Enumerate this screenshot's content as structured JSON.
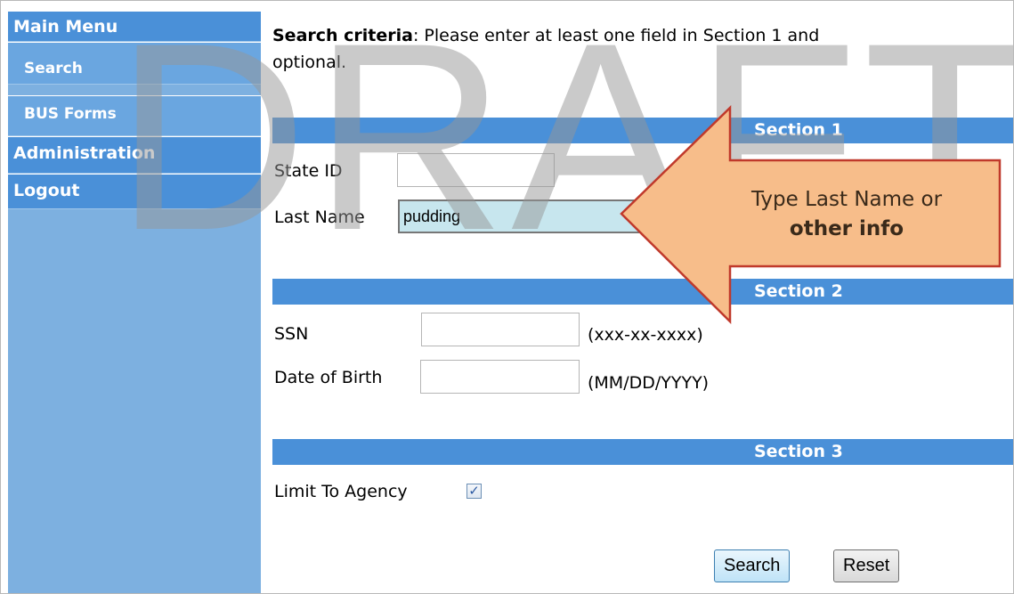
{
  "sidebar": {
    "items": [
      {
        "label": "Main Menu"
      },
      {
        "label": "Search"
      },
      {
        "label": "BUS Forms"
      },
      {
        "label": "Administration"
      },
      {
        "label": "Logout"
      }
    ]
  },
  "main": {
    "criteria_bold": "Search criteria",
    "criteria_line1": ": Please enter at least one field in Section 1 and",
    "criteria_line2": "optional.",
    "section1": {
      "title": "Section 1",
      "state_id_label": "State ID",
      "state_id_value": "",
      "last_name_label": "Last Name",
      "last_name_value": "pudding"
    },
    "section2": {
      "title": "Section 2",
      "ssn_label": "SSN",
      "ssn_value": "",
      "ssn_hint": "(xxx-xx-xxxx)",
      "dob_label": "Date of Birth",
      "dob_value": "",
      "dob_hint": "(MM/DD/YYYY)"
    },
    "section3": {
      "title": "Section 3",
      "limit_label": "Limit To Agency",
      "limit_checked": "✓"
    },
    "buttons": {
      "search": "Search",
      "reset": "Reset"
    }
  },
  "watermark": "DRAFT",
  "callout": {
    "line1": "Type Last Name or",
    "line2": "other info"
  },
  "colors": {
    "sidebar_bg": "#7db0e0",
    "menu_header": "#4a90d8",
    "section_bar": "#4a90d8",
    "callout_fill": "#f7bd8a",
    "callout_border": "#c0392b",
    "filled_input": "#c7e6ee"
  }
}
